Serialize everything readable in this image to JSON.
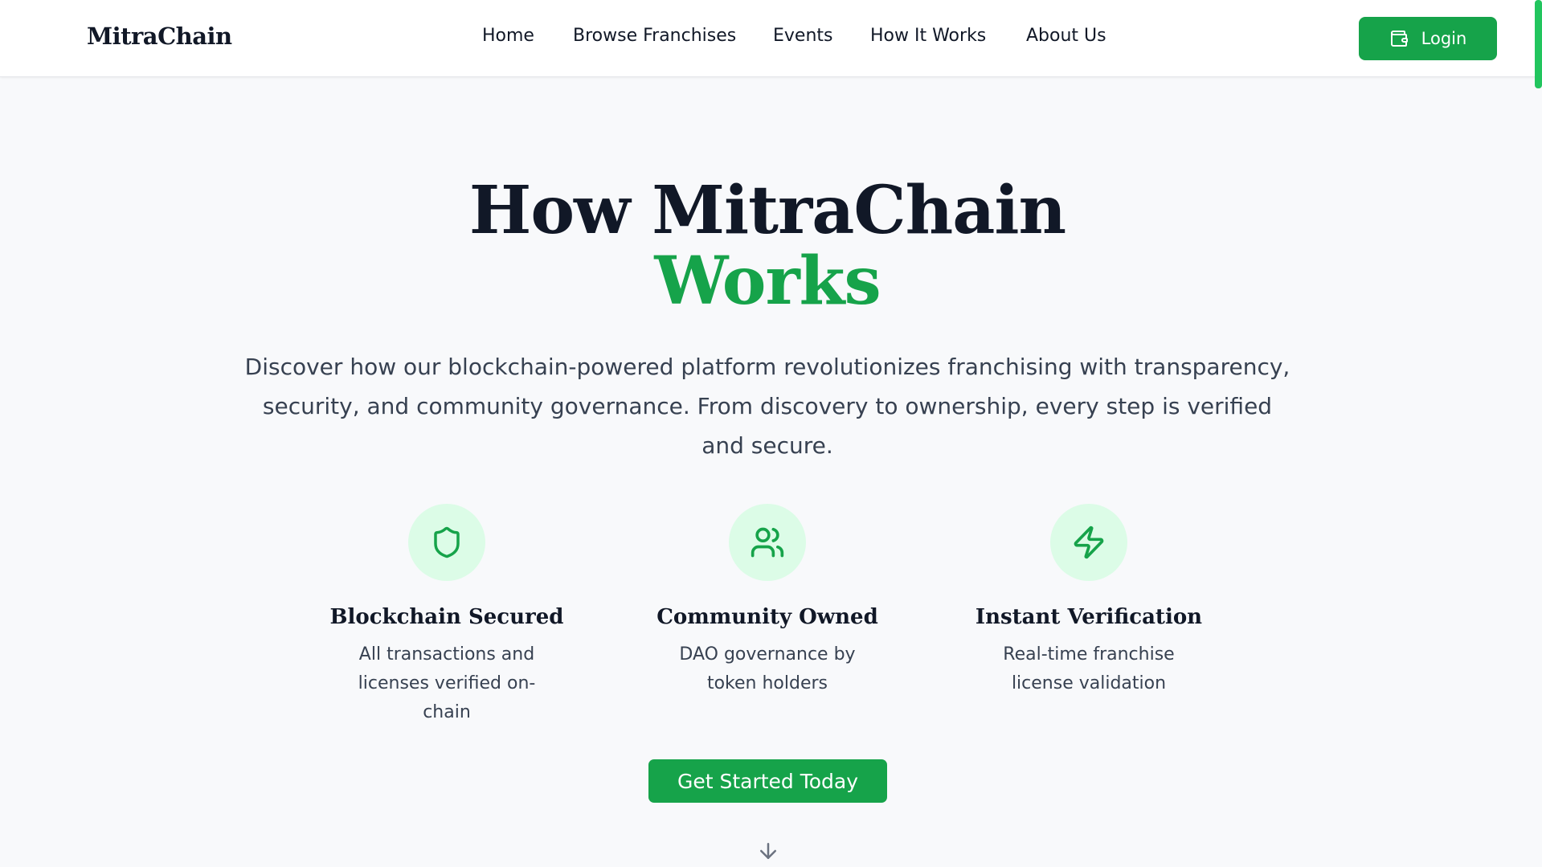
{
  "header": {
    "logo": "MitraChain",
    "nav": [
      {
        "label": "Home"
      },
      {
        "label": "Browse Franchises"
      },
      {
        "label": "Events"
      },
      {
        "label": "How It Works"
      },
      {
        "label": "About Us"
      }
    ],
    "login_label": "Login",
    "login_icon": "wallet-icon"
  },
  "hero": {
    "title_line1": "How MitraChain",
    "title_line2": "Works",
    "description": "Discover how our blockchain-powered platform revolutionizes franchising with transparency, security, and community governance. From discovery to ownership, every step is verified and secure."
  },
  "features": [
    {
      "icon": "shield-icon",
      "title": "Blockchain Secured",
      "description": "All transactions and licenses verified on-chain"
    },
    {
      "icon": "users-icon",
      "title": "Community Owned",
      "description": "DAO governance by token holders"
    },
    {
      "icon": "lightning-icon",
      "title": "Instant Verification",
      "description": "Real-time franchise license validation"
    }
  ],
  "cta_label": "Get Started Today",
  "scroll_icon": "arrow-down-icon",
  "colors": {
    "accent": "#16a34a",
    "accent_light": "#dcfce7",
    "text_dark": "#111827",
    "text_body": "#374151",
    "background": "#f8f9fb"
  }
}
